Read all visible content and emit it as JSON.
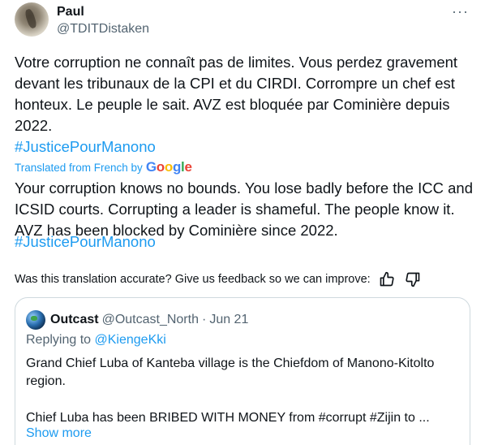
{
  "author": {
    "name": "Paul",
    "handle": "@TDITDistaken"
  },
  "menu": {
    "more_label": "···",
    "icon": "more-horizontal-icon"
  },
  "tweet": {
    "text": "Votre corruption ne connaît pas de limites. Vous perdez gravement devant les tribunaux de la CPI et du CIRDI. Corrompre un chef est honteux. Le peuple le sait. AVZ est bloquée par Cominière depuis 2022.",
    "hashtag": "#JusticePourManono"
  },
  "translation": {
    "label": "Translated from French by",
    "provider_letters": [
      "G",
      "o",
      "o",
      "g",
      "l",
      "e"
    ],
    "text": "Your corruption knows no bounds. You lose badly before the ICC and ICSID courts. Corrupting a leader is shameful. The people know it. AVZ has been blocked by Cominière since 2022.",
    "hashtag": "#JusticePourManono"
  },
  "feedback": {
    "question": "Was this translation accurate? Give us feedback so we can improve:",
    "up_icon": "thumbs-up-icon",
    "down_icon": "thumbs-down-icon"
  },
  "quote": {
    "name": "Outcast",
    "handle": "@Outcast_North",
    "separator": "·",
    "date": "Jun 21",
    "replying_label": "Replying to",
    "replying_to": "@KiengeKki",
    "text1": "Grand Chief Luba of Kanteba village is the Chiefdom of Manono-Kitolto region.",
    "text2": "Chief Luba has been BRIBED WITH MONEY from #corrupt #Zijin to ...",
    "show_more": "Show more"
  },
  "colors": {
    "text": "#0f1419",
    "secondary": "#536471",
    "link": "#1d9bf0",
    "border": "#cfd9de"
  }
}
